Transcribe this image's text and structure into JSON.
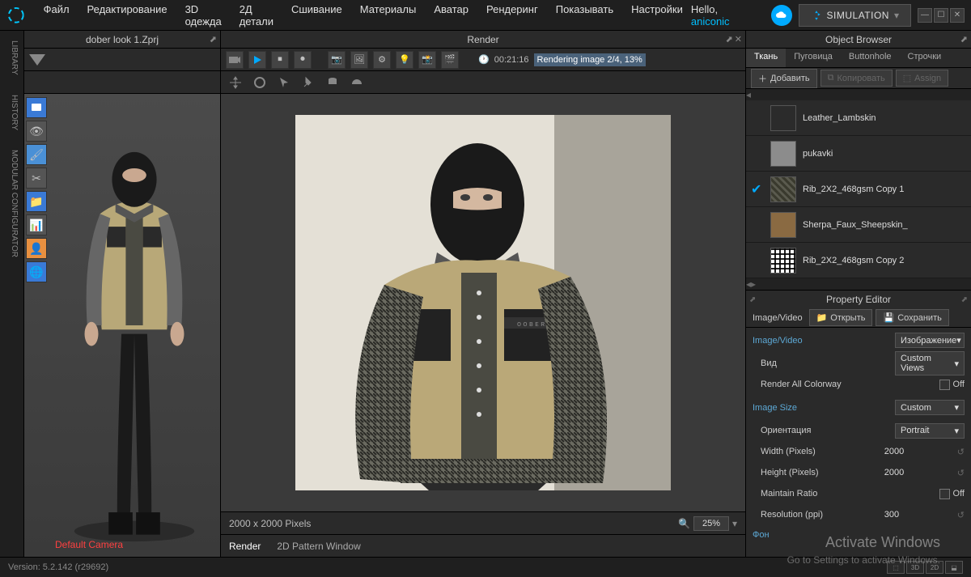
{
  "menu": {
    "items": [
      "Файл",
      "Редактирование",
      "3D одежда",
      "2Д детали",
      "Сшивание",
      "Материалы",
      "Аватар",
      "Рендеринг",
      "Показывать",
      "Настройки"
    ],
    "hello": "Hello,",
    "user": "aniconic",
    "simulation": "SIMULATION"
  },
  "side_tabs": [
    "LIBRARY",
    "HISTORY",
    "MODULAR CONFIGURATOR"
  ],
  "left_panel": {
    "title": "dober look 1.Zprj",
    "camera_label": "Default Camera"
  },
  "center_panel": {
    "title": "Render",
    "timecode": "00:21:16",
    "progress": "Rendering image 2/4, 13%",
    "dimensions": "2000 x 2000 Pixels",
    "zoom": "25%",
    "tabs": [
      "Render",
      "2D Pattern Window"
    ]
  },
  "right_panel": {
    "title": "Object Browser",
    "tabs": [
      "Ткань",
      "Пуговица",
      "Buttonhole",
      "Строчки"
    ],
    "actions": {
      "add": "Добавить",
      "copy": "Копировать",
      "assign": "Assign"
    },
    "fabrics": [
      {
        "name": "Leather_Lambskin",
        "swatch": "#2b2b2b"
      },
      {
        "name": "pukavki",
        "swatch": "#8c8c8c"
      },
      {
        "name": "Rib_2X2_468gsm Copy 1",
        "swatch": "#3a3a2e",
        "selected": true
      },
      {
        "name": "Sherpa_Faux_Sheepskin_",
        "swatch": "#8a6a42"
      },
      {
        "name": "Rib_2X2_468gsm Copy 2",
        "swatch": "#f0f0f0"
      }
    ]
  },
  "prop_editor": {
    "title": "Property Editor",
    "toolbar": {
      "tab": "Image/Video",
      "open": "Открыть",
      "save": "Сохранить"
    },
    "section1": {
      "label": "Image/Video",
      "value_dropdown": "Изображение",
      "view_label": "Вид",
      "view_value": "Custom Views",
      "colorway_label": "Render All Colorway",
      "colorway_value": "Off"
    },
    "section2": {
      "label": "Image Size",
      "value_dropdown": "Custom",
      "orient_label": "Ориентация",
      "orient_value": "Portrait",
      "width_label": "Width (Pixels)",
      "width_value": "2000",
      "height_label": "Height (Pixels)",
      "height_value": "2000",
      "ratio_label": "Maintain Ratio",
      "ratio_value": "Off",
      "res_label": "Resolution (ppi)",
      "res_value": "300"
    },
    "section3": {
      "label": "Фон"
    }
  },
  "footer": {
    "version": "Version: 5.2.142 (r29692)",
    "buttons": [
      "⬚",
      "3D",
      "2D",
      "⬓"
    ]
  },
  "watermark": {
    "title": "Activate Windows",
    "sub": "Go to Settings to activate Windows."
  }
}
